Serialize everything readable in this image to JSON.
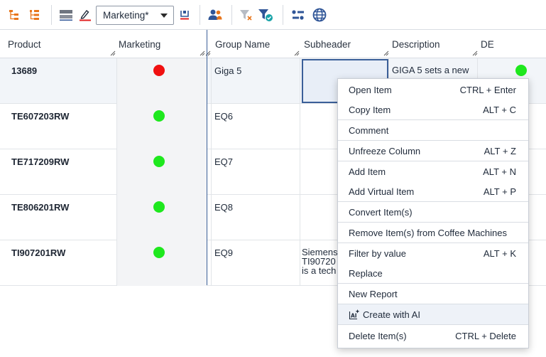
{
  "toolbar": {
    "view_select": {
      "value": "Marketing*"
    },
    "icons": [
      "tree-expand-icon",
      "tree-collapse-icon",
      "row-height-icon",
      "highlight-icon",
      "save-view-icon",
      "users-icon",
      "clear-filter-icon",
      "filter-applied-icon",
      "column-settings-icon",
      "language-globe-icon"
    ]
  },
  "grid": {
    "columns": [
      "Product",
      "Marketing",
      "Group Name",
      "Subheader",
      "Description",
      "DE"
    ],
    "rows": [
      {
        "product": "13689",
        "marketing_status": "red",
        "group": "Giga 5",
        "subheader": "",
        "description": "GIGA 5 sets a new",
        "de_status": "green"
      },
      {
        "product": "TE607203RW",
        "marketing_status": "green",
        "group": "EQ6",
        "subheader": "",
        "description": "",
        "de_status": ""
      },
      {
        "product": "TE717209RW",
        "marketing_status": "green",
        "group": "EQ7",
        "subheader": "",
        "description": "",
        "de_status": ""
      },
      {
        "product": "TE806201RW",
        "marketing_status": "green",
        "group": "EQ8",
        "subheader": "",
        "description": "",
        "de_status": ""
      },
      {
        "product": "TI907201RW",
        "marketing_status": "green",
        "group": "EQ9",
        "subheader": "Siemens\nTI90720\nis a tech",
        "description": "",
        "de_status": ""
      }
    ]
  },
  "context_menu": {
    "items": [
      {
        "label": "Open Item",
        "shortcut": "CTRL + Enter"
      },
      {
        "label": "Copy Item",
        "shortcut": "ALT + C"
      },
      {
        "label": "Comment",
        "shortcut": ""
      },
      {
        "label": "Unfreeze Column",
        "shortcut": "ALT + Z"
      },
      {
        "label": "Add Item",
        "shortcut": "ALT + N"
      },
      {
        "label": "Add Virtual Item",
        "shortcut": "ALT + P"
      },
      {
        "label": "Convert Item(s)",
        "shortcut": ""
      },
      {
        "label": "Remove Item(s) from Coffee Machines",
        "shortcut": ""
      },
      {
        "label": "Filter by value",
        "shortcut": "ALT + K"
      },
      {
        "label": "Replace",
        "shortcut": ""
      },
      {
        "label": "New Report",
        "shortcut": ""
      },
      {
        "label": "Create with AI",
        "shortcut": ""
      },
      {
        "label": "Delete Item(s)",
        "shortcut": "CTRL + Delete"
      }
    ],
    "highlighted_index": 11
  },
  "colors": {
    "status_green": "#1ee81e",
    "status_red": "#f01010",
    "accent_blue": "#2f5597",
    "frozen_divider": "#3b5f98"
  }
}
